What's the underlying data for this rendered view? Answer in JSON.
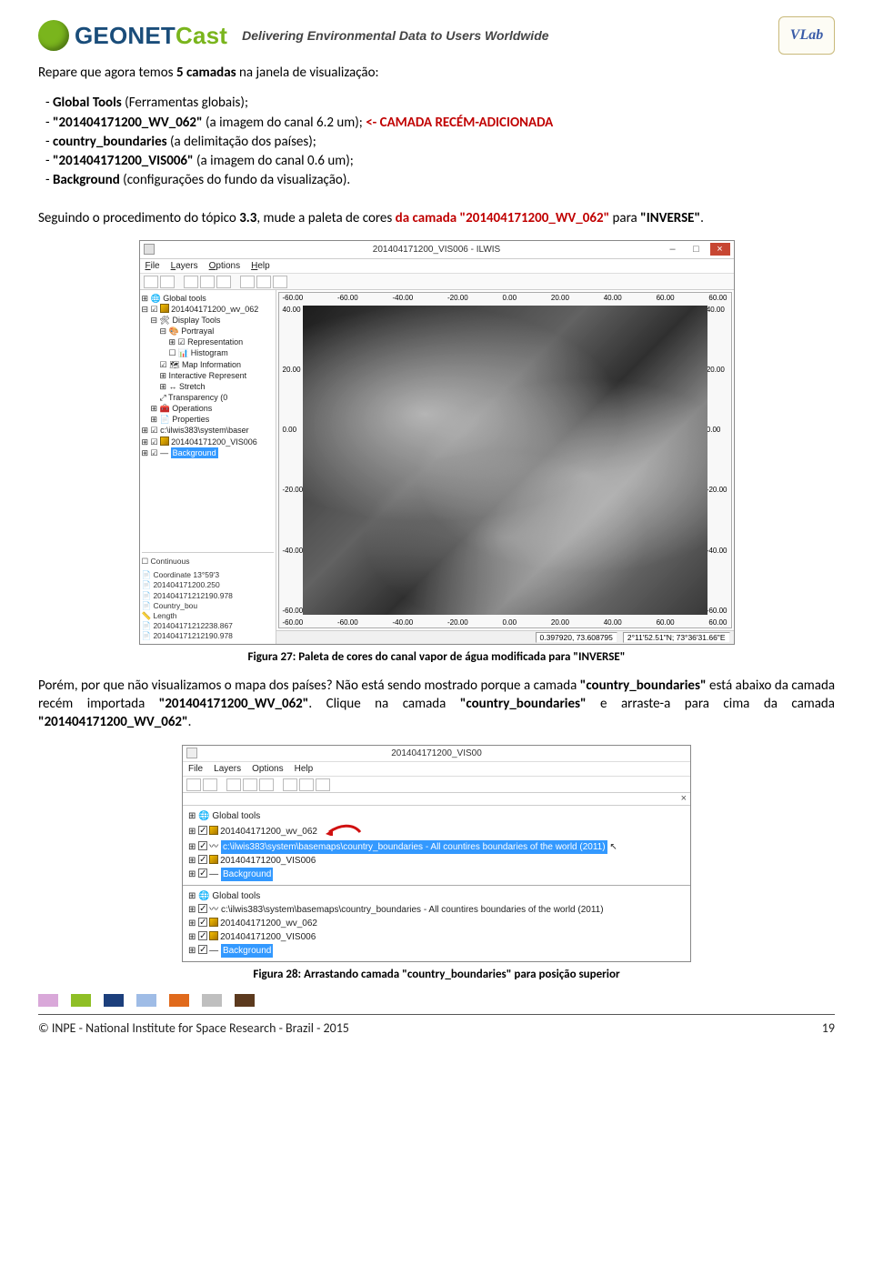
{
  "header": {
    "brand_geo": "GEO",
    "brand_net": "NET",
    "brand_cast": "Cast",
    "tagline": "Delivering Environmental Data to Users Worldwide",
    "vlab": "VLab"
  },
  "intro": {
    "line1_pre": "Repare que agora temos ",
    "line1_bold": "5 camadas",
    "line1_post": " na janela de visualização:"
  },
  "list": {
    "i1_pre": "- ",
    "i1_b": "Global Tools",
    "i1_post": " (Ferramentas globais);",
    "i2_pre": "- ",
    "i2_b": "\"201404171200_WV_062\"",
    "i2_mid": " (a imagem do canal 6.2 um); ",
    "i2_red": "<- CAMADA RECÉM-ADICIONADA",
    "i3_pre": "- ",
    "i3_b": "country_boundaries",
    "i3_post": " (a delimitação dos países);",
    "i4_pre": "- ",
    "i4_b": "\"201404171200_VIS006\"",
    "i4_post": " (a imagem do canal 0.6 um);",
    "i5_pre": "- ",
    "i5_b": "Background",
    "i5_post": " (configurações do fundo da visualização)."
  },
  "para2": {
    "t1": "Seguindo o procedimento do tópico ",
    "b1": "3.3",
    "t2": ", mude a paleta de cores ",
    "r1": "da camada \"201404171200_WV_062\"",
    "t3": " para ",
    "b2": "\"INVERSE\"",
    "t4": "."
  },
  "fig27": {
    "title": "201404171200_VIS006 - ILWIS",
    "menu": {
      "file": "File",
      "layers": "Layers",
      "options": "Options",
      "help": "Help"
    },
    "x_ticks": [
      "-60.00",
      "-60.00",
      "-40.00",
      "-20.00",
      "0.00",
      "20.00",
      "40.00",
      "60.00",
      "60.00"
    ],
    "y_ticks": [
      "40.00",
      "20.00",
      "0.00",
      "-20.00",
      "-40.00",
      "-60.00"
    ],
    "tree": {
      "t0": "Global tools",
      "t1": "201404171200_wv_062",
      "t2": "Display Tools",
      "t3": "Portrayal",
      "t4": "Representation",
      "t5": "Histogram",
      "t6": "Map Information",
      "t7": "Interactive Represent",
      "t8": "Stretch",
      "t9": "Transparency (0",
      "t10": "Operations",
      "t11": "Properties",
      "t12": "c:\\ilwis383\\system\\baser",
      "t13": "201404171200_VIS006",
      "t14": "Background"
    },
    "info": {
      "l0": "Continuous",
      "l1": "Coordinate  13°59'3",
      "l2": "201404171200.250",
      "l3": "201404171212190.978",
      "l4": "Country_bou",
      "l5": "Length",
      "l6": "201404171212238.867",
      "l7": "201404171212190.978"
    },
    "status": {
      "s1": "0.397920, 73.608795",
      "s2": "2°11'52.51\"N; 73°36'31.66\"E"
    },
    "caption": "Figura 27: Paleta de cores do canal vapor de água modificada para \"INVERSE\""
  },
  "para3": {
    "t1": "Porém, por que não visualizamos o mapa dos países? Não está sendo mostrado porque a camada ",
    "b1": "\"country_boundaries\"",
    "t2": " está abaixo da camada recém importada ",
    "b2": "\"201404171200_WV_062\"",
    "t3": ". Clique na camada ",
    "b3": "\"country_boundaries\"",
    "t4": " e arraste-a para cima da camada ",
    "b4": "\"201404171200_WV_062\"",
    "t5": "."
  },
  "fig28": {
    "title": "201404171200_VIS00",
    "menu": {
      "file": "File",
      "layers": "Layers",
      "options": "Options",
      "help": "Help"
    },
    "top": {
      "r0": "Global tools",
      "r1": "201404171200_wv_062",
      "r2": "c:\\ilwis383\\system\\basemaps\\country_boundaries - All countires boundaries of the world (2011)",
      "r3": "201404171200_VIS006",
      "r4": "Background"
    },
    "bottom": {
      "r0": "Global tools",
      "r1": "c:\\ilwis383\\system\\basemaps\\country_boundaries - All countires boundaries of the world (2011)",
      "r2": "201404171200_wv_062",
      "r3": "201404171200_VIS006",
      "r4": "Background"
    },
    "caption": "Figura 28: Arrastando camada \"country_boundaries\" para posição superior"
  },
  "footer": {
    "swatches": [
      "#d9a8d9",
      "#8fbf26",
      "#1c3f7c",
      "#9fbce6",
      "#e06a1c",
      "#bfbfbf",
      "#5c3a1e"
    ],
    "copyright": "© INPE - National Institute for Space Research - Brazil - 2015",
    "page": "19"
  }
}
